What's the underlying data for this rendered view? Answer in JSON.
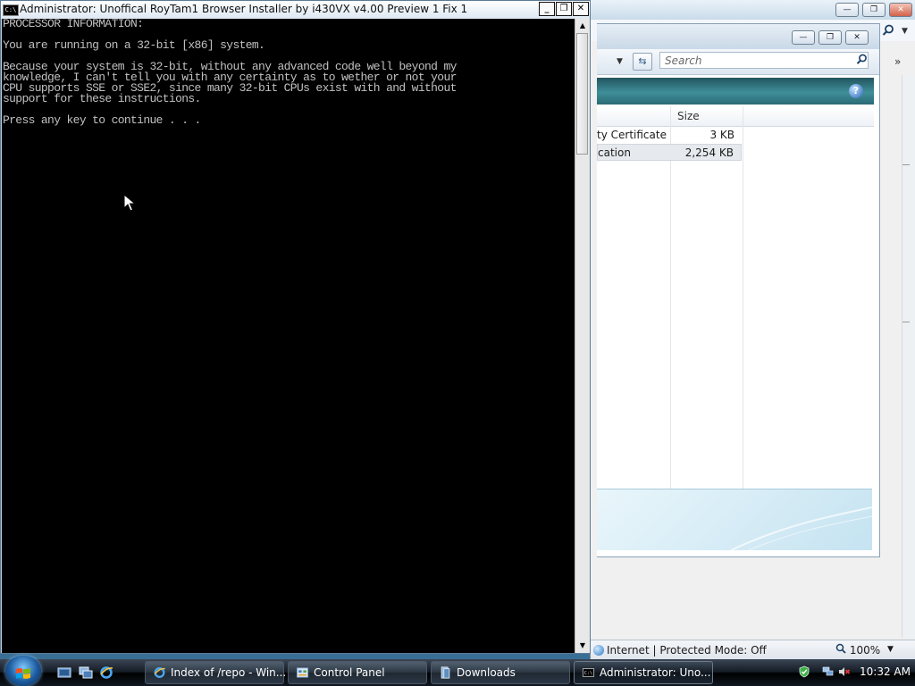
{
  "browser": {
    "search_icon": "magnifier-icon",
    "status_text": "Internet | Protected Mode: Off",
    "zoom": "100%"
  },
  "explorer": {
    "search_placeholder": "Search",
    "help_label": "?",
    "column_size": "Size",
    "files": [
      {
        "name": "ty Certificate",
        "size": "3 KB"
      },
      {
        "name": "cation",
        "size": "2,254 KB"
      }
    ]
  },
  "console": {
    "title": "Administrator:  Unoffical RoyTam1 Browser Installer by i430VX v4.00 Preview 1 Fix 1",
    "icon_label": "C:\\",
    "output": "PROCESSOR INFORMATION:\n\nYou are running on a 32-bit [x86] system.\n\nBecause your system is 32-bit, without any advanced code well beyond my\nknowledge, I can't tell you with any certainty as to wether or not your\nCPU supports SSE or SSE2, since many 32-bit CPUs exist with and without\nsupport for these instructions.\n\nPress any key to continue . . ."
  },
  "taskbar": {
    "buttons": [
      {
        "label": "Index of /repo - Win...",
        "icon": "ie-icon"
      },
      {
        "label": "Control Panel",
        "icon": "control-panel-icon"
      },
      {
        "label": "Downloads",
        "icon": "folder-icon"
      },
      {
        "label": "Administrator:  Uno...",
        "icon": "console-icon"
      }
    ],
    "clock": "10:32 AM"
  },
  "colors": {
    "console_bg": "#000000",
    "console_text": "#c0c0c0",
    "explorer_command_bar": "#2f7a85",
    "taskbar": "#121a24"
  }
}
